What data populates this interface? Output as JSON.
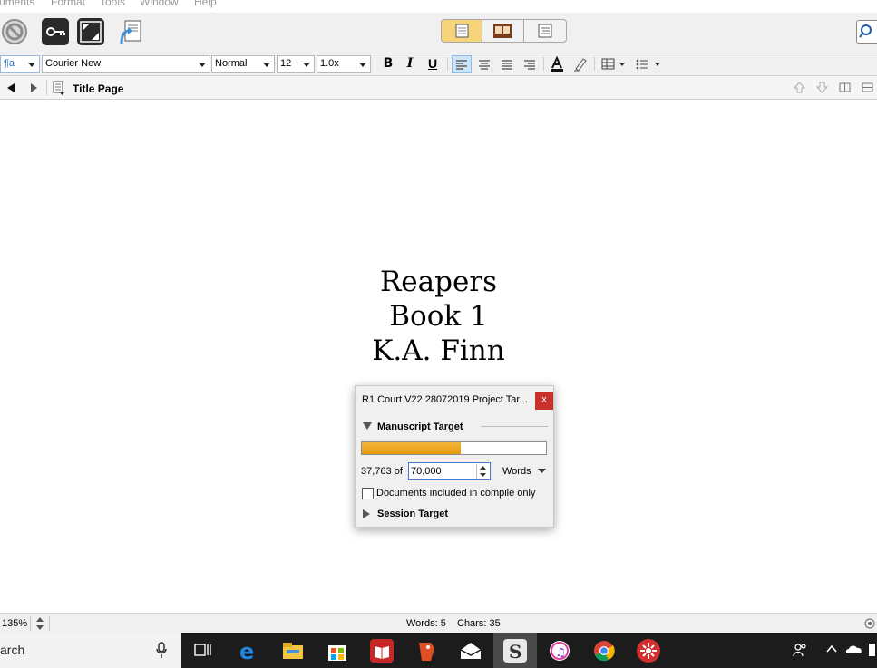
{
  "menu": [
    "uments",
    "Format",
    "Tools",
    "Window",
    "Help"
  ],
  "format_bar": {
    "style_label": "¶a",
    "font": "Courier New",
    "typeface": "Normal",
    "size": "12",
    "spacing": "1.0x",
    "bold": "B",
    "italic": "I",
    "underline": "U"
  },
  "header": {
    "document_title": "Title Page"
  },
  "editor": {
    "lines": [
      "Reapers",
      "Book 1",
      "K.A. Finn"
    ]
  },
  "target_panel": {
    "title": "R1 Court V22 28072019 Project Tar...",
    "close_label": "x",
    "manuscript_label": "Manuscript Target",
    "progress_fraction": 0.539,
    "current_prefix": "37,763 of",
    "target_value": "70,000",
    "unit": "Words",
    "checkbox_label": "Documents included in compile only",
    "checkbox_checked": false,
    "session_label": "Session Target"
  },
  "status_bar": {
    "zoom": "135%",
    "words": "Words: 5",
    "chars": "Chars: 35"
  },
  "taskbar": {
    "search_text": "arch"
  },
  "colors": {
    "progress": "#e9a51f",
    "close": "#c9302c",
    "active_view": "#f6d57a"
  }
}
